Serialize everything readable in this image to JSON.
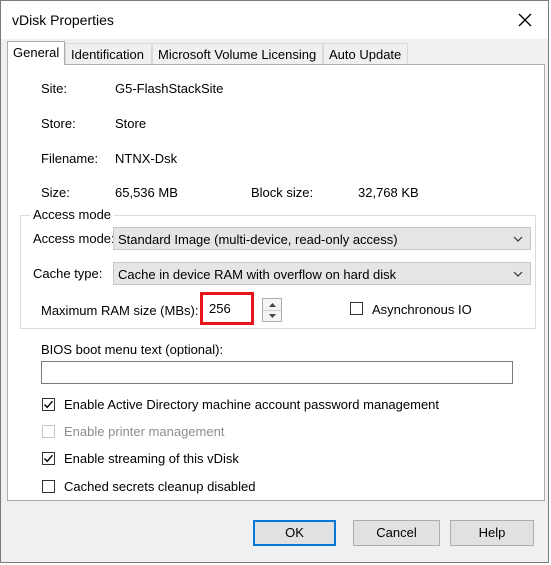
{
  "window": {
    "title": "vDisk Properties"
  },
  "tabs": [
    {
      "label": "General"
    },
    {
      "label": "Identification"
    },
    {
      "label": "Microsoft Volume Licensing"
    },
    {
      "label": "Auto Update"
    }
  ],
  "general": {
    "site_label": "Site:",
    "site_value": "G5-FlashStackSite",
    "store_label": "Store:",
    "store_value": "Store",
    "filename_label": "Filename:",
    "filename_value": "NTNX-Dsk",
    "size_label": "Size:",
    "size_value": "65,536 MB",
    "block_size_label": "Block size:",
    "block_size_value": "32,768 KB"
  },
  "access_group": {
    "legend": "Access mode",
    "access_mode_label": "Access mode:",
    "access_mode_value": "Standard Image (multi-device, read-only access)",
    "cache_type_label": "Cache type:",
    "cache_type_value": "Cache in device RAM with overflow on hard disk",
    "max_ram_label": "Maximum RAM size (MBs):",
    "max_ram_value": "256",
    "async_io_label": "Asynchronous IO",
    "async_io_checked": false
  },
  "bios": {
    "label": "BIOS boot menu text (optional):",
    "value": ""
  },
  "options": {
    "ad_label": "Enable Active Directory machine account password management",
    "ad_checked": true,
    "printer_label": "Enable printer management",
    "printer_checked": false,
    "streaming_label": "Enable streaming of this vDisk",
    "streaming_checked": true,
    "cached_secrets_label": "Cached secrets cleanup disabled",
    "cached_secrets_checked": false
  },
  "buttons": {
    "ok": "OK",
    "cancel": "Cancel",
    "help": "Help"
  },
  "colors": {
    "highlight_box": "#e8141b",
    "default_button_border": "#0078d7"
  }
}
